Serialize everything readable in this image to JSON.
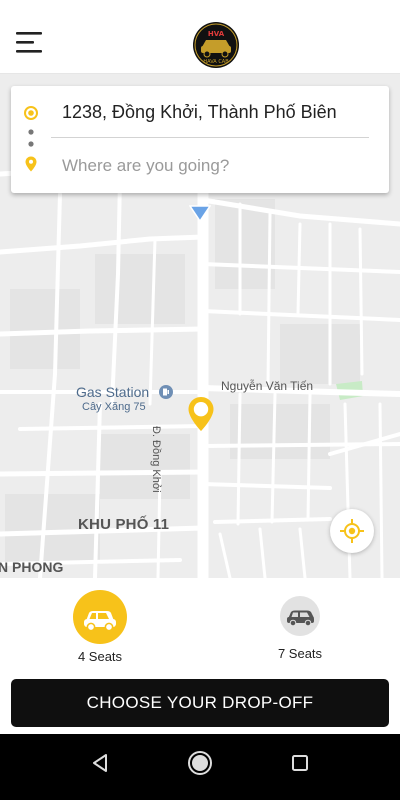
{
  "app": {
    "logo_text": "HAVA CAB",
    "logo_monogram": "HVA"
  },
  "colors": {
    "accent": "#f7c21a",
    "map_bg": "#ededed",
    "road": "#ffffff",
    "cta_bg": "#0f0f0f",
    "park_green": "#c8ebc6"
  },
  "search": {
    "origin": "1238, Đồng Khởi, Thành Phố Biên",
    "destination_placeholder": "Where are you going?"
  },
  "map": {
    "labels": {
      "gas_station": "Gas Station",
      "gas_station_sub": "Cây Xăng 75",
      "street_nguyen": "Nguyễn Văn Tiến",
      "street_dong_khoi": "Đ. Đồng Khởi",
      "area_khu_pho": "KHU PHỐ 11",
      "area_phong": "N PHONG"
    },
    "icons": [
      "menu-icon",
      "origin-pin-icon",
      "destination-pin-icon",
      "pickup-marker-icon",
      "gas-station-icon",
      "my-location-icon",
      "navigation-arrow-icon"
    ]
  },
  "vehicles": [
    {
      "label": "4 Seats",
      "selected": true
    },
    {
      "label": "7 Seats",
      "selected": false
    }
  ],
  "cta": {
    "label": "CHOOSE YOUR DROP-OFF"
  },
  "android_nav": {
    "buttons": [
      "back",
      "home",
      "recents"
    ]
  }
}
